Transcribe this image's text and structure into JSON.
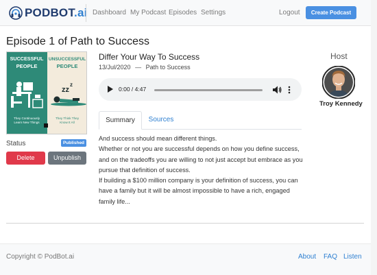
{
  "brand": {
    "name_main": "PODBOT",
    "name_suffix": ".ai"
  },
  "nav": {
    "links": [
      "Dashboard",
      "My Podcast",
      "Episodes",
      "Settings"
    ],
    "logout": "Logout",
    "create_button": "Create Podcast"
  },
  "page": {
    "title": "Episode 1 of Path to Success"
  },
  "cover": {
    "left_title": "SUCCESSFUL PEOPLE",
    "right_title": "UNSUCCESSFUL PEOPLE",
    "left_caption": "They Continuously Learn New Things",
    "right_caption": "They Think They Know It All",
    "left_color": "#2e8a78",
    "right_color": "#f3ebdc"
  },
  "status": {
    "label": "Status",
    "badge": "Published"
  },
  "actions": {
    "delete": "Delete",
    "unpublish": "Unpublish"
  },
  "episode": {
    "title": "Differ Your Way To Success",
    "date": "13/Jul/2020",
    "separator": "—",
    "podcast": "Path to Success"
  },
  "player": {
    "time": "0:00 / 4:47",
    "progress": 0
  },
  "tabs": [
    "Summary",
    "Sources"
  ],
  "summary": [
    "And success should mean different things.",
    "Whether or not you are successful depends on how you define success, and on the tradeoffs you are willing to not just accept but embrace as you pursue that definition of success.",
    "If building a $100 million company is your definition of success, you can have a family but it will be almost impossible to have a rich, engaged family life..."
  ],
  "host": {
    "label": "Host",
    "name": "Troy Kennedy"
  },
  "footer": {
    "copyright": "Copyright © PodBot.ai",
    "links": [
      "About",
      "FAQ",
      "Listen"
    ]
  },
  "colors": {
    "primary": "#4a90e2",
    "danger": "#e0394a",
    "secondary": "#6c757d"
  }
}
